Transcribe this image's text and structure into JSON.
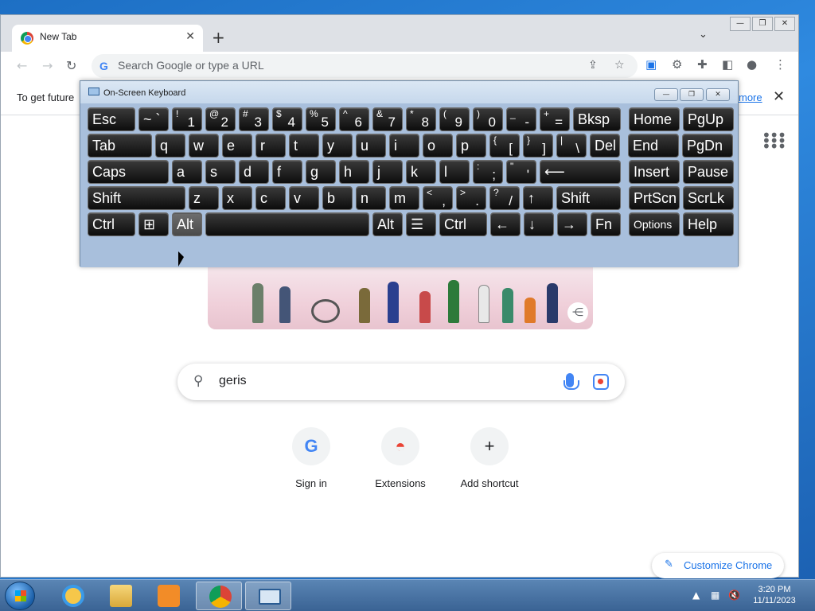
{
  "browser": {
    "tab_title": "New Tab",
    "omnibox_placeholder": "Search Google or type a URL",
    "infobar_text": "To get future",
    "infobar_link": "more",
    "window_controls": [
      "—",
      "❐",
      "✕"
    ]
  },
  "osk": {
    "title": "On-Screen Keyboard",
    "rows": [
      [
        {
          "main": "Esc"
        },
        {
          "main": "~ `"
        },
        {
          "sm": "!",
          "bt": "1"
        },
        {
          "sm": "@",
          "bt": "2"
        },
        {
          "sm": "#",
          "bt": "3"
        },
        {
          "sm": "$",
          "bt": "4"
        },
        {
          "sm": "%",
          "bt": "5"
        },
        {
          "sm": "^",
          "bt": "6"
        },
        {
          "sm": "&",
          "bt": "7"
        },
        {
          "sm": "*",
          "bt": "8"
        },
        {
          "sm": "(",
          "bt": "9"
        },
        {
          "sm": ")",
          "bt": "0"
        },
        {
          "sm": "_",
          "bt": "-"
        },
        {
          "sm": "+",
          "bt": "="
        },
        {
          "main": "Bksp"
        },
        {
          "main": "Home"
        },
        {
          "main": "PgUp"
        }
      ],
      [
        {
          "main": "Tab"
        },
        {
          "main": "q"
        },
        {
          "main": "w"
        },
        {
          "main": "e"
        },
        {
          "main": "r"
        },
        {
          "main": "t"
        },
        {
          "main": "y"
        },
        {
          "main": "u"
        },
        {
          "main": "i"
        },
        {
          "main": "o"
        },
        {
          "main": "p"
        },
        {
          "sm": "{",
          "bt": "["
        },
        {
          "sm": "}",
          "bt": "]"
        },
        {
          "sm": "|",
          "bt": "\\"
        },
        {
          "main": "Del"
        },
        {
          "main": "End"
        },
        {
          "main": "PgDn"
        }
      ],
      [
        {
          "main": "Caps"
        },
        {
          "main": "a"
        },
        {
          "main": "s"
        },
        {
          "main": "d"
        },
        {
          "main": "f"
        },
        {
          "main": "g"
        },
        {
          "main": "h"
        },
        {
          "main": "j"
        },
        {
          "main": "k"
        },
        {
          "main": "l"
        },
        {
          "sm": ":",
          "bt": ";"
        },
        {
          "sm": "\"",
          "bt": "'"
        },
        {
          "main": "⟵"
        },
        {
          "main": "Insert"
        },
        {
          "main": "Pause"
        }
      ],
      [
        {
          "main": "Shift"
        },
        {
          "main": "z"
        },
        {
          "main": "x"
        },
        {
          "main": "c"
        },
        {
          "main": "v"
        },
        {
          "main": "b"
        },
        {
          "main": "n"
        },
        {
          "main": "m"
        },
        {
          "sm": "<",
          "bt": ","
        },
        {
          "sm": ">",
          "bt": "."
        },
        {
          "sm": "?",
          "bt": "/"
        },
        {
          "main": "↑"
        },
        {
          "main": "Shift"
        },
        {
          "main": "PrtScn"
        },
        {
          "main": "ScrLk"
        }
      ],
      [
        {
          "main": "Ctrl"
        },
        {
          "main": "⊞"
        },
        {
          "main": "Alt",
          "pressed": true
        },
        {
          "main": ""
        },
        {
          "main": "Alt"
        },
        {
          "main": "☰"
        },
        {
          "main": "Ctrl"
        },
        {
          "main": "←"
        },
        {
          "main": "↓"
        },
        {
          "main": "→"
        },
        {
          "main": "Fn"
        },
        {
          "main": "Options"
        },
        {
          "main": "Help"
        }
      ]
    ]
  },
  "page": {
    "search_value": "geris",
    "shortcuts": [
      {
        "label": "Sign in",
        "glyph": "G"
      },
      {
        "label": "Extensions",
        "glyph": "◓"
      },
      {
        "label": "Add shortcut",
        "glyph": "+"
      }
    ],
    "customize_label": "Customize Chrome"
  },
  "taskbar": {
    "time": "3:20 PM",
    "date": "11/11/2023"
  }
}
